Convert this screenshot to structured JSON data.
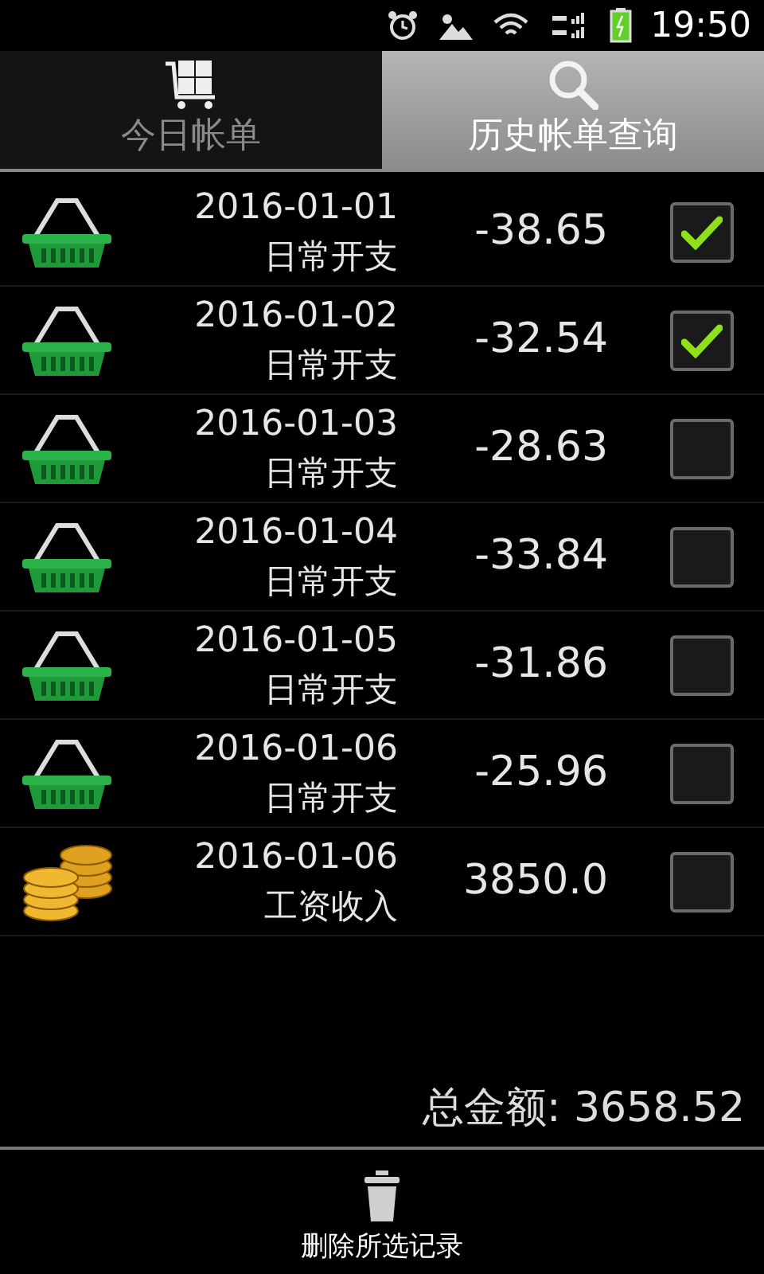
{
  "status_bar": {
    "time": "19:50"
  },
  "tabs": [
    {
      "label": "今日帐单",
      "selected": false,
      "kind": "cart"
    },
    {
      "label": "历史帐单查询",
      "selected": true,
      "kind": "search"
    }
  ],
  "records": [
    {
      "kind": "expense",
      "date": "2016-01-01",
      "category": "日常开支",
      "amount": "-38.65",
      "checked": true
    },
    {
      "kind": "expense",
      "date": "2016-01-02",
      "category": "日常开支",
      "amount": "-32.54",
      "checked": true
    },
    {
      "kind": "expense",
      "date": "2016-01-03",
      "category": "日常开支",
      "amount": "-28.63",
      "checked": false
    },
    {
      "kind": "expense",
      "date": "2016-01-04",
      "category": "日常开支",
      "amount": "-33.84",
      "checked": false
    },
    {
      "kind": "expense",
      "date": "2016-01-05",
      "category": "日常开支",
      "amount": "-31.86",
      "checked": false
    },
    {
      "kind": "expense",
      "date": "2016-01-06",
      "category": "日常开支",
      "amount": "-25.96",
      "checked": false
    },
    {
      "kind": "income",
      "date": "2016-01-06",
      "category": "工资收入",
      "amount": "3850.0",
      "checked": false
    }
  ],
  "total": "总金额: 3658.52",
  "bottom_bar": {
    "delete_button": "删除所选记录"
  }
}
